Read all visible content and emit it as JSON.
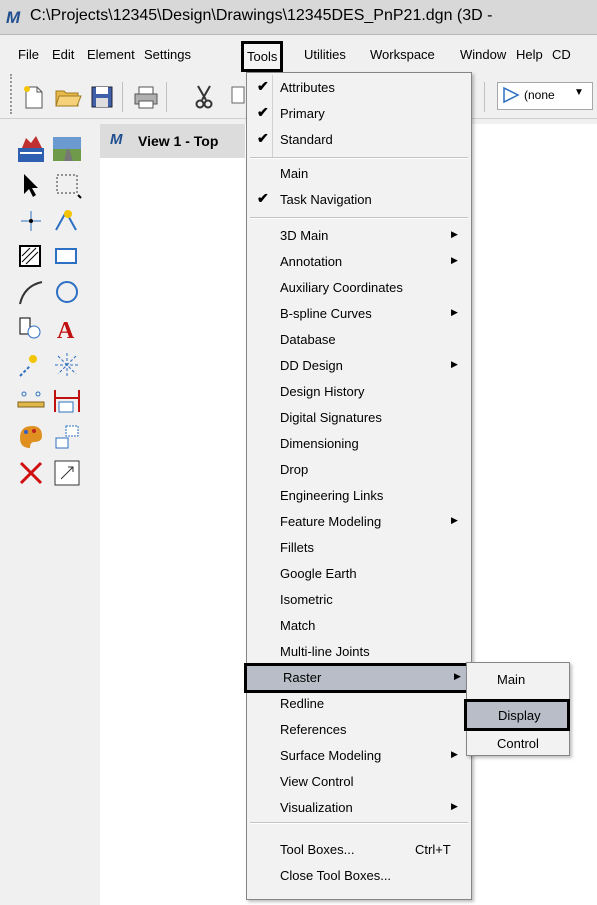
{
  "window": {
    "title": "C:\\Projects\\12345\\Design\\Drawings\\12345DES_PnP21.dgn (3D - "
  },
  "menubar": [
    "File",
    "Edit",
    "Element",
    "Settings",
    "Tools",
    "Utilities",
    "Workspace",
    "Window",
    "Help",
    "CD"
  ],
  "toolbar": {
    "combo_value": "(none"
  },
  "view": {
    "title": "View 1 - Top"
  },
  "tools_menu": {
    "checked": [
      "Attributes",
      "Primary",
      "Standard"
    ],
    "group2": [
      {
        "label": "Main",
        "checked": false
      },
      {
        "label": "Task Navigation",
        "checked": true
      }
    ],
    "items": [
      {
        "label": "3D Main",
        "submenu": true
      },
      {
        "label": "Annotation",
        "submenu": true
      },
      {
        "label": "Auxiliary Coordinates",
        "submenu": false
      },
      {
        "label": "B-spline Curves",
        "submenu": true
      },
      {
        "label": "Database",
        "submenu": false
      },
      {
        "label": "DD Design",
        "submenu": true
      },
      {
        "label": "Design History",
        "submenu": false
      },
      {
        "label": "Digital Signatures",
        "submenu": false
      },
      {
        "label": "Dimensioning",
        "submenu": false
      },
      {
        "label": "Drop",
        "submenu": false
      },
      {
        "label": "Engineering Links",
        "submenu": false
      },
      {
        "label": "Feature Modeling",
        "submenu": true
      },
      {
        "label": "Fillets",
        "submenu": false
      },
      {
        "label": "Google Earth",
        "submenu": false
      },
      {
        "label": "Isometric",
        "submenu": false
      },
      {
        "label": "Match",
        "submenu": false
      },
      {
        "label": "Multi-line Joints",
        "submenu": false
      },
      {
        "label": "Raster",
        "submenu": true
      },
      {
        "label": "Redline",
        "submenu": false
      },
      {
        "label": "References",
        "submenu": false
      },
      {
        "label": "Surface Modeling",
        "submenu": true
      },
      {
        "label": "View Control",
        "submenu": false
      },
      {
        "label": "Visualization",
        "submenu": true
      }
    ],
    "bottom": [
      {
        "label": "Tool Boxes...",
        "shortcut": "Ctrl+T"
      },
      {
        "label": "Close Tool Boxes...",
        "shortcut": ""
      }
    ]
  },
  "raster_submenu": [
    "Main",
    "Display",
    "Control"
  ],
  "colors": {
    "highlight": "#b9bdc8",
    "menu_bg": "#f2f2f2",
    "title_icon": "#1f4f8f"
  }
}
